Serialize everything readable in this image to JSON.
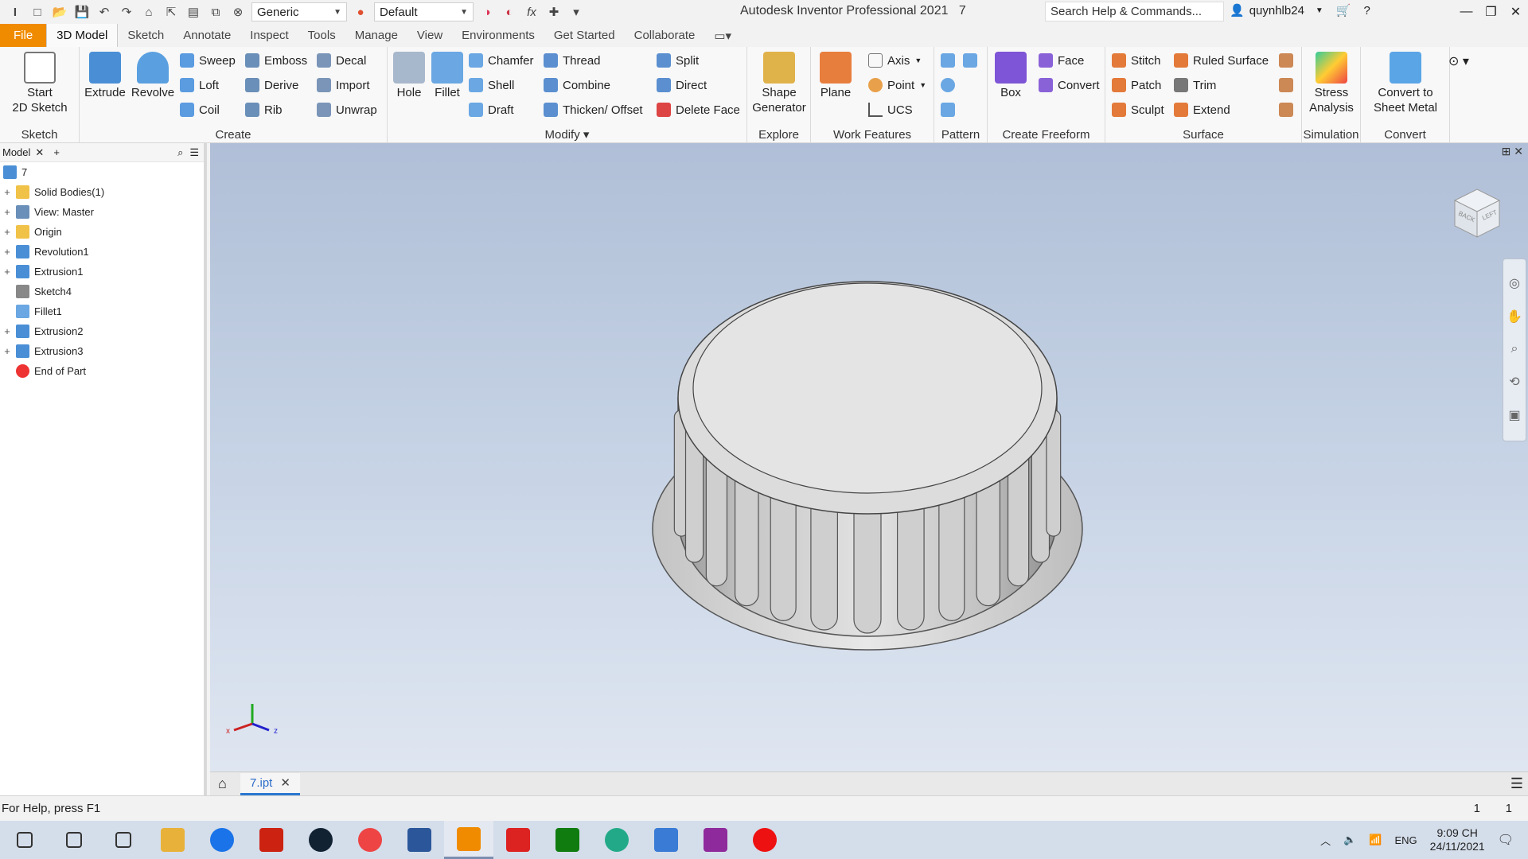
{
  "titlebar": {
    "app_title": "Autodesk Inventor Professional 2021",
    "doc_name": "7",
    "material": "Generic",
    "appearance": "Default",
    "search_placeholder": "Search Help & Commands...",
    "user": "quynhlb24"
  },
  "tabs": [
    "File",
    "3D Model",
    "Sketch",
    "Annotate",
    "Inspect",
    "Tools",
    "Manage",
    "View",
    "Environments",
    "Get Started",
    "Collaborate"
  ],
  "ribbon": {
    "sketch_panel": {
      "label": "Sketch",
      "start_sketch": "Start\n2D Sketch"
    },
    "create_panel": {
      "label": "Create",
      "extrude": "Extrude",
      "revolve": "Revolve",
      "sweep": "Sweep",
      "loft": "Loft",
      "coil": "Coil",
      "emboss": "Emboss",
      "derive": "Derive",
      "rib": "Rib",
      "decal": "Decal",
      "import": "Import",
      "unwrap": "Unwrap"
    },
    "modify_panel": {
      "label": "Modify",
      "hole": "Hole",
      "fillet": "Fillet",
      "chamfer": "Chamfer",
      "shell": "Shell",
      "draft": "Draft",
      "thread": "Thread",
      "combine": "Combine",
      "thicken": "Thicken/ Offset",
      "split": "Split",
      "direct": "Direct",
      "delete_face": "Delete Face"
    },
    "explore_panel": {
      "label": "Explore",
      "shape_generator": "Shape\nGenerator"
    },
    "work_panel": {
      "label": "Work Features",
      "plane": "Plane",
      "axis": "Axis",
      "point": "Point",
      "ucs": "UCS"
    },
    "pattern_panel": {
      "label": "Pattern"
    },
    "freeform_panel": {
      "label": "Create Freeform",
      "box": "Box",
      "face": "Face",
      "convert": "Convert"
    },
    "surface_panel": {
      "label": "Surface",
      "stitch": "Stitch",
      "patch": "Patch",
      "sculpt": "Sculpt",
      "ruled": "Ruled Surface",
      "trim": "Trim",
      "extend": "Extend"
    },
    "simulation_panel": {
      "label": "Simulation",
      "stress": "Stress\nAnalysis"
    },
    "convert_panel": {
      "label": "Convert",
      "sheet_metal": "Convert to\nSheet Metal"
    }
  },
  "browser": {
    "tab_label": "Model",
    "root": "7",
    "items": [
      {
        "label": "Solid Bodies(1)",
        "icon": "folder-icon",
        "expandable": true
      },
      {
        "label": "View: Master",
        "icon": "view-icon",
        "expandable": true
      },
      {
        "label": "Origin",
        "icon": "folder-icon",
        "expandable": true
      },
      {
        "label": "Revolution1",
        "icon": "revolve-icon",
        "expandable": true
      },
      {
        "label": "Extrusion1",
        "icon": "extrude-icon",
        "expandable": true
      },
      {
        "label": "Sketch4",
        "icon": "sketch-icon",
        "expandable": false
      },
      {
        "label": "Fillet1",
        "icon": "fillet-icon",
        "expandable": false
      },
      {
        "label": "Extrusion2",
        "icon": "extrude-icon",
        "expandable": true
      },
      {
        "label": "Extrusion3",
        "icon": "extrude-icon",
        "expandable": true
      },
      {
        "label": "End of Part",
        "icon": "end-of-part-icon",
        "expandable": false
      }
    ]
  },
  "viewcube": {
    "back": "BACK",
    "left": "LEFT"
  },
  "doc_tab": "7.ipt",
  "status": {
    "help": "For Help, press F1",
    "count1": "1",
    "count2": "1"
  },
  "taskbar": {
    "apps": [
      "start-icon",
      "search-icon",
      "taskview-icon",
      "explorer-icon",
      "zalo-icon",
      "app-red-icon",
      "steam-icon",
      "chrome-icon",
      "word-icon",
      "inventor-icon",
      "acrobat-icon",
      "xbox-icon",
      "chrome-alt-icon",
      "photos-icon",
      "pdf-icon",
      "record-icon"
    ],
    "lang": "ENG",
    "time": "9:09 CH",
    "date": "24/11/2021"
  },
  "colors": {
    "file_tab": "#f08b00",
    "accent": "#2b78d1",
    "viewport_top": "#b0bfd7",
    "viewport_bottom": "#dfe6f1"
  }
}
